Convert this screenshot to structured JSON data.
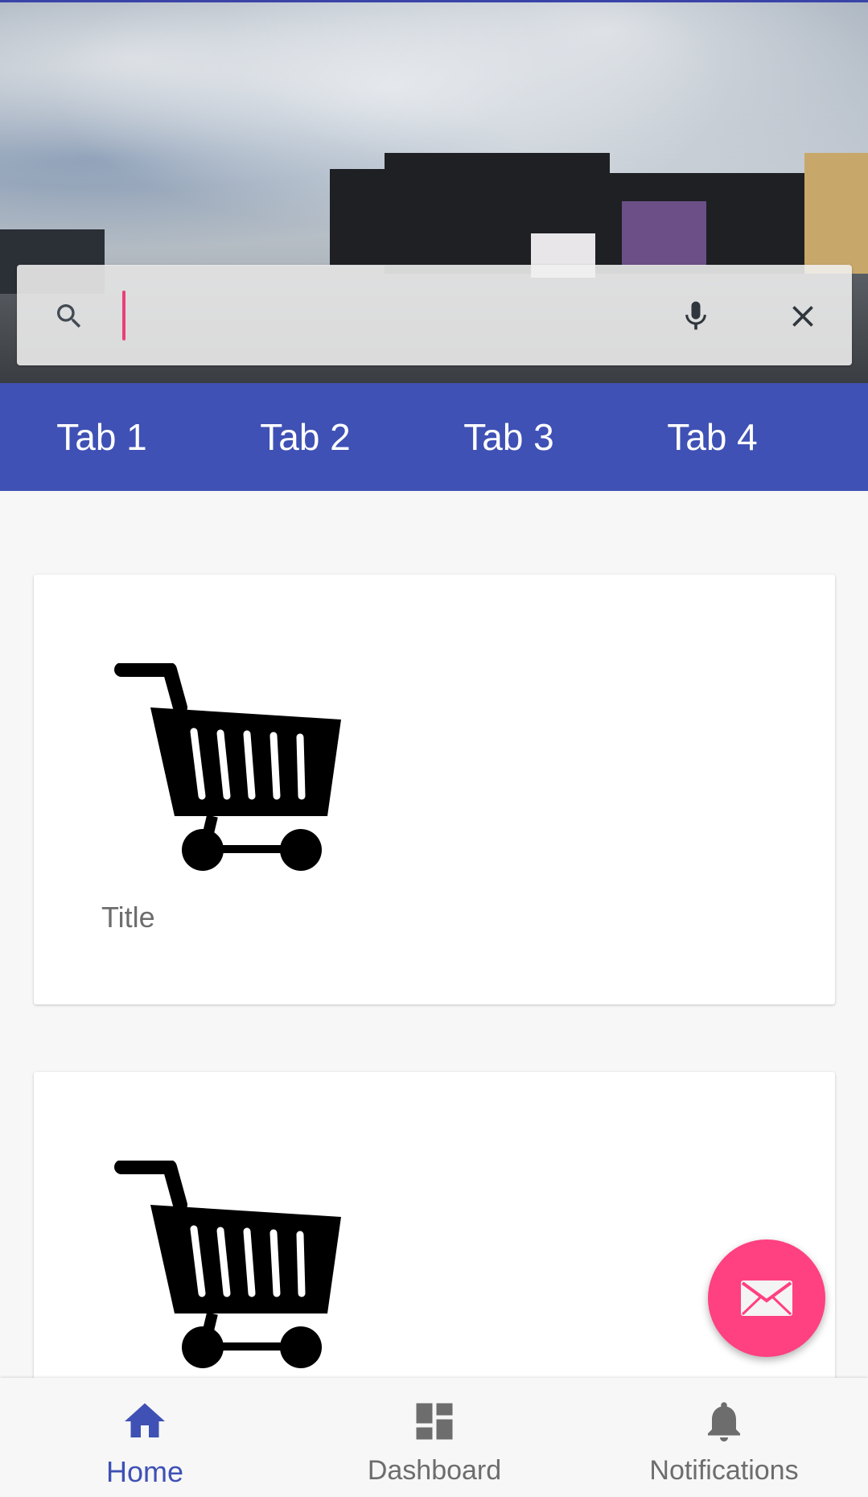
{
  "search": {
    "value": "",
    "placeholder": ""
  },
  "tabs": [
    {
      "label": "Tab 1"
    },
    {
      "label": "Tab 2"
    },
    {
      "label": "Tab 3"
    },
    {
      "label": "Tab 4"
    }
  ],
  "cards": [
    {
      "icon": "shopping-cart-icon",
      "title": "Title"
    },
    {
      "icon": "shopping-cart-icon",
      "title": ""
    }
  ],
  "fab": {
    "icon": "mail-icon"
  },
  "bottom_nav": {
    "items": [
      {
        "label": "Home",
        "icon": "home-icon",
        "active": true
      },
      {
        "label": "Dashboard",
        "icon": "dashboard-icon",
        "active": false
      },
      {
        "label": "Notifications",
        "icon": "bell-icon",
        "active": false
      }
    ]
  },
  "colors": {
    "primary": "#3f51b5",
    "accent": "#ff4081",
    "background": "#f7f7f7"
  }
}
